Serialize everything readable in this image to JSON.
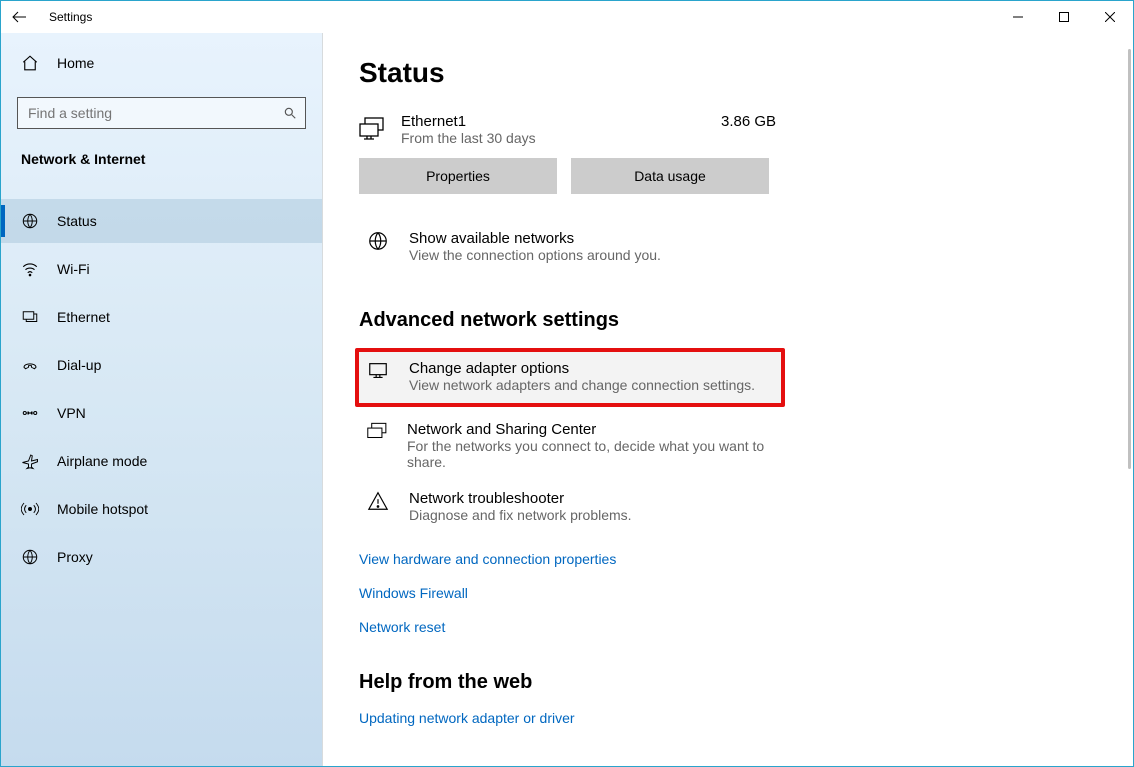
{
  "window": {
    "title": "Settings"
  },
  "sidebar": {
    "home": "Home",
    "search_placeholder": "Find a setting",
    "category": "Network & Internet",
    "items": [
      {
        "label": "Status",
        "selected": true
      },
      {
        "label": "Wi-Fi",
        "selected": false
      },
      {
        "label": "Ethernet",
        "selected": false
      },
      {
        "label": "Dial-up",
        "selected": false
      },
      {
        "label": "VPN",
        "selected": false
      },
      {
        "label": "Airplane mode",
        "selected": false
      },
      {
        "label": "Mobile hotspot",
        "selected": false
      },
      {
        "label": "Proxy",
        "selected": false
      }
    ]
  },
  "main": {
    "page_title": "Status",
    "connection": {
      "name": "Ethernet1",
      "subtitle": "From the last 30 days",
      "usage": "3.86 GB",
      "btn_properties": "Properties",
      "btn_data_usage": "Data usage"
    },
    "available_networks": {
      "title": "Show available networks",
      "subtitle": "View the connection options around you."
    },
    "advanced_heading": "Advanced network settings",
    "change_adapter": {
      "title": "Change adapter options",
      "subtitle": "View network adapters and change connection settings."
    },
    "sharing_center": {
      "title": "Network and Sharing Center",
      "subtitle": "For the networks you connect to, decide what you want to share."
    },
    "troubleshooter": {
      "title": "Network troubleshooter",
      "subtitle": "Diagnose and fix network problems."
    },
    "links": {
      "hardware_props": "View hardware and connection properties",
      "firewall": "Windows Firewall",
      "reset": "Network reset"
    },
    "help_heading": "Help from the web",
    "help_link": "Updating network adapter or driver"
  }
}
